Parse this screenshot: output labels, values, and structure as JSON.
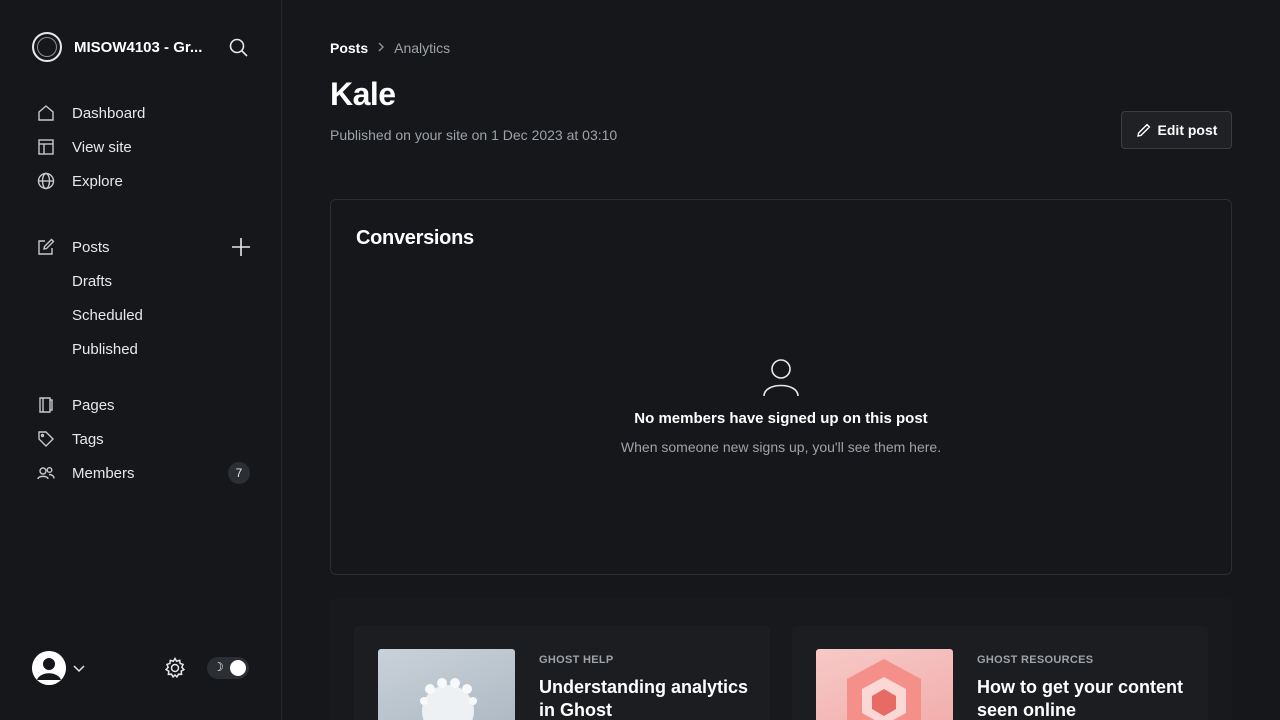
{
  "sidebar": {
    "site_name": "MISOW4103 - Gr...",
    "nav_primary": [
      {
        "label": "Dashboard",
        "icon": "home-icon"
      },
      {
        "label": "View site",
        "icon": "layout-icon"
      },
      {
        "label": "Explore",
        "icon": "globe-icon"
      }
    ],
    "posts": {
      "label": "Posts",
      "icon": "edit-icon"
    },
    "posts_sub": [
      {
        "label": "Drafts"
      },
      {
        "label": "Scheduled"
      },
      {
        "label": "Published"
      }
    ],
    "nav_secondary": [
      {
        "label": "Pages",
        "icon": "page-icon"
      },
      {
        "label": "Tags",
        "icon": "tag-icon"
      },
      {
        "label": "Members",
        "icon": "members-icon"
      }
    ],
    "members_count": "7"
  },
  "breadcrumb": {
    "parent": "Posts",
    "current": "Analytics"
  },
  "post": {
    "title": "Kale",
    "published": "Published on your site on 1 Dec 2023 at 03:10",
    "edit_label": "Edit post"
  },
  "conversions": {
    "title": "Conversions",
    "empty_title": "No members have signed up on this post",
    "empty_subtitle": "When someone new signs up, you'll see them here."
  },
  "help": [
    {
      "tag": "GHOST HELP",
      "title": "Understanding analytics in Ghost"
    },
    {
      "tag": "GHOST RESOURCES",
      "title": "How to get your content seen online"
    }
  ],
  "colors": {
    "background": "#15171a",
    "text": "#e6e8eb",
    "muted": "#9ea3a8",
    "border": "#2b2e33"
  }
}
